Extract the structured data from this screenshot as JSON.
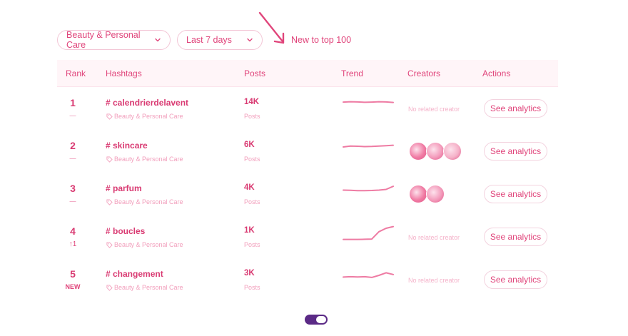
{
  "filters": {
    "category": "Beauty & Personal Care",
    "period": "Last 7 days",
    "new_to_top": "New to top 100"
  },
  "columns": {
    "rank": "Rank",
    "hashtags": "Hashtags",
    "posts": "Posts",
    "trend": "Trend",
    "creators": "Creators",
    "actions": "Actions"
  },
  "rows": [
    {
      "rank": "1",
      "change": "—",
      "hashtag": "# calendrierdelavent",
      "category": "Beauty & Personal Care",
      "posts": "14K",
      "posts_label": "Posts",
      "creators_text": "No related creator",
      "creator_count": 0,
      "action": "See analytics",
      "trend": [
        0.62,
        0.64,
        0.63,
        0.61,
        0.62,
        0.64,
        0.63,
        0.6
      ]
    },
    {
      "rank": "2",
      "change": "—",
      "hashtag": "# skincare",
      "category": "Beauty & Personal Care",
      "posts": "6K",
      "posts_label": "Posts",
      "creators_text": "",
      "creator_count": 3,
      "action": "See analytics",
      "trend": [
        0.5,
        0.55,
        0.54,
        0.52,
        0.53,
        0.55,
        0.57,
        0.6
      ]
    },
    {
      "rank": "3",
      "change": "—",
      "hashtag": "# parfum",
      "category": "Beauty & Personal Care",
      "posts": "4K",
      "posts_label": "Posts",
      "creators_text": "",
      "creator_count": 2,
      "action": "See analytics",
      "trend": [
        0.48,
        0.47,
        0.45,
        0.45,
        0.46,
        0.48,
        0.52,
        0.7
      ]
    },
    {
      "rank": "4",
      "change": "↑1",
      "hashtag": "# boucles",
      "category": "Beauty & Personal Care",
      "posts": "1K",
      "posts_label": "Posts",
      "creators_text": "No related creator",
      "creator_count": 0,
      "action": "See analytics",
      "trend": [
        0.1,
        0.1,
        0.1,
        0.11,
        0.12,
        0.55,
        0.75,
        0.85
      ]
    },
    {
      "rank": "5",
      "change": "NEW",
      "hashtag": "# changement",
      "category": "Beauty & Personal Care",
      "posts": "3K",
      "posts_label": "Posts",
      "creators_text": "No related creator",
      "creator_count": 0,
      "action": "See analytics",
      "trend": [
        0.4,
        0.42,
        0.41,
        0.42,
        0.38,
        0.5,
        0.65,
        0.55
      ]
    }
  ],
  "colors": {
    "accent": "#e0457b",
    "toggle": "#5b2a86",
    "header_bg": "#fff5f8"
  },
  "icons": {
    "dropdown": "chevron-down-icon",
    "category": "tag-icon",
    "annotation": "arrow-icon"
  }
}
